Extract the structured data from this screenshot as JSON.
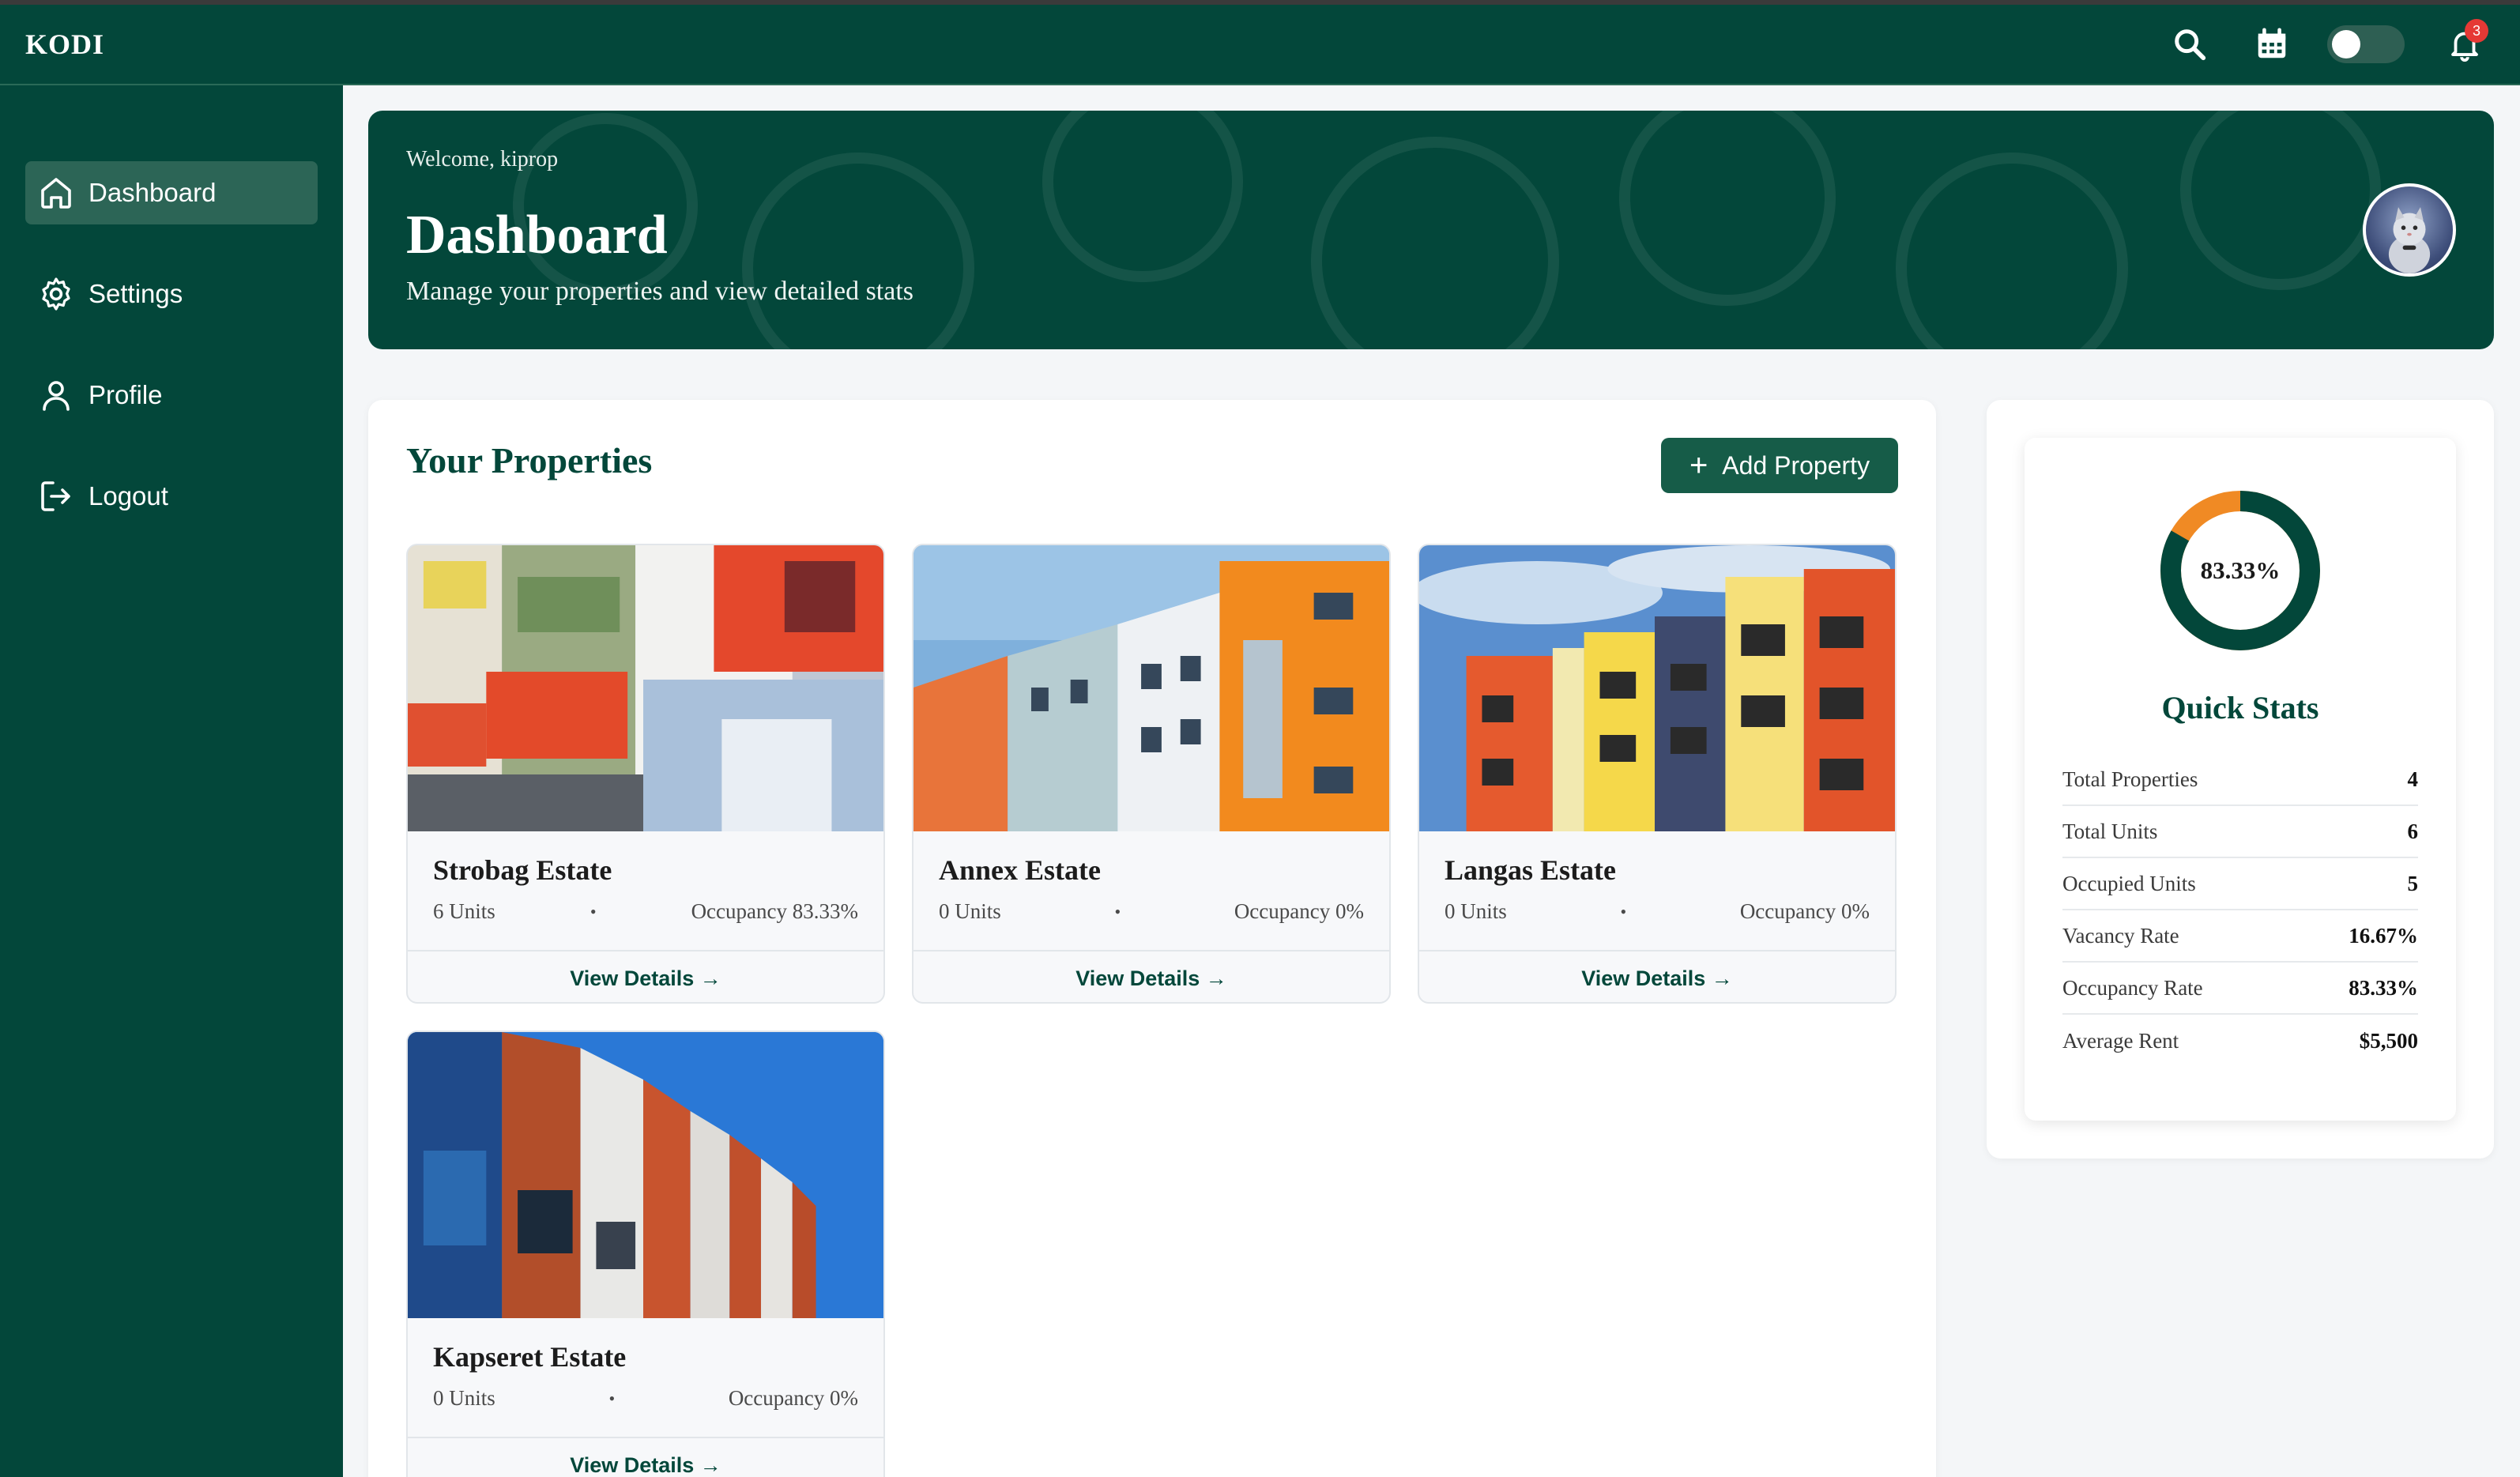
{
  "app": {
    "brand": "KODI",
    "notification_count": "3",
    "icons": [
      "search-icon",
      "calendar-icon",
      "bell-icon"
    ],
    "colors": {
      "primary": "#03473a",
      "accent": "#f08a24",
      "active_nav": "#2c6556"
    }
  },
  "sidebar": {
    "items": [
      {
        "label": "Dashboard",
        "icon": "home-icon",
        "active": true
      },
      {
        "label": "Settings",
        "icon": "gear-icon",
        "active": false
      },
      {
        "label": "Profile",
        "icon": "user-icon",
        "active": false
      },
      {
        "label": "Logout",
        "icon": "logout-icon",
        "active": false
      }
    ]
  },
  "header": {
    "welcome": "Welcome, kiprop",
    "title": "Dashboard",
    "subtitle": "Manage your properties and view detailed stats"
  },
  "properties": {
    "title": "Your Properties",
    "add_button": "Add Property",
    "items": [
      {
        "name": "Strobag Estate",
        "units": "6 Units",
        "occupancy": "Occupancy 83.33%",
        "link": "View Details →"
      },
      {
        "name": "Annex Estate",
        "units": "0 Units",
        "occupancy": "Occupancy 0%",
        "link": "View Details →"
      },
      {
        "name": "Langas Estate",
        "units": "0 Units",
        "occupancy": "Occupancy 0%",
        "link": "View Details →"
      },
      {
        "name": "Kapseret Estate",
        "units": "0 Units",
        "occupancy": "Occupancy 0%",
        "link": "View Details →"
      }
    ]
  },
  "quick_stats": {
    "title": "Quick Stats",
    "donut_label": "83.33%",
    "occupancy_fraction": 0.8333,
    "rows": [
      {
        "label": "Total Properties",
        "value": "4"
      },
      {
        "label": "Total Units",
        "value": "6"
      },
      {
        "label": "Occupied Units",
        "value": "5"
      },
      {
        "label": "Vacancy Rate",
        "value": "16.67%"
      },
      {
        "label": "Occupancy Rate",
        "value": "83.33%"
      },
      {
        "label": "Average Rent",
        "value": "$5,500"
      }
    ]
  }
}
